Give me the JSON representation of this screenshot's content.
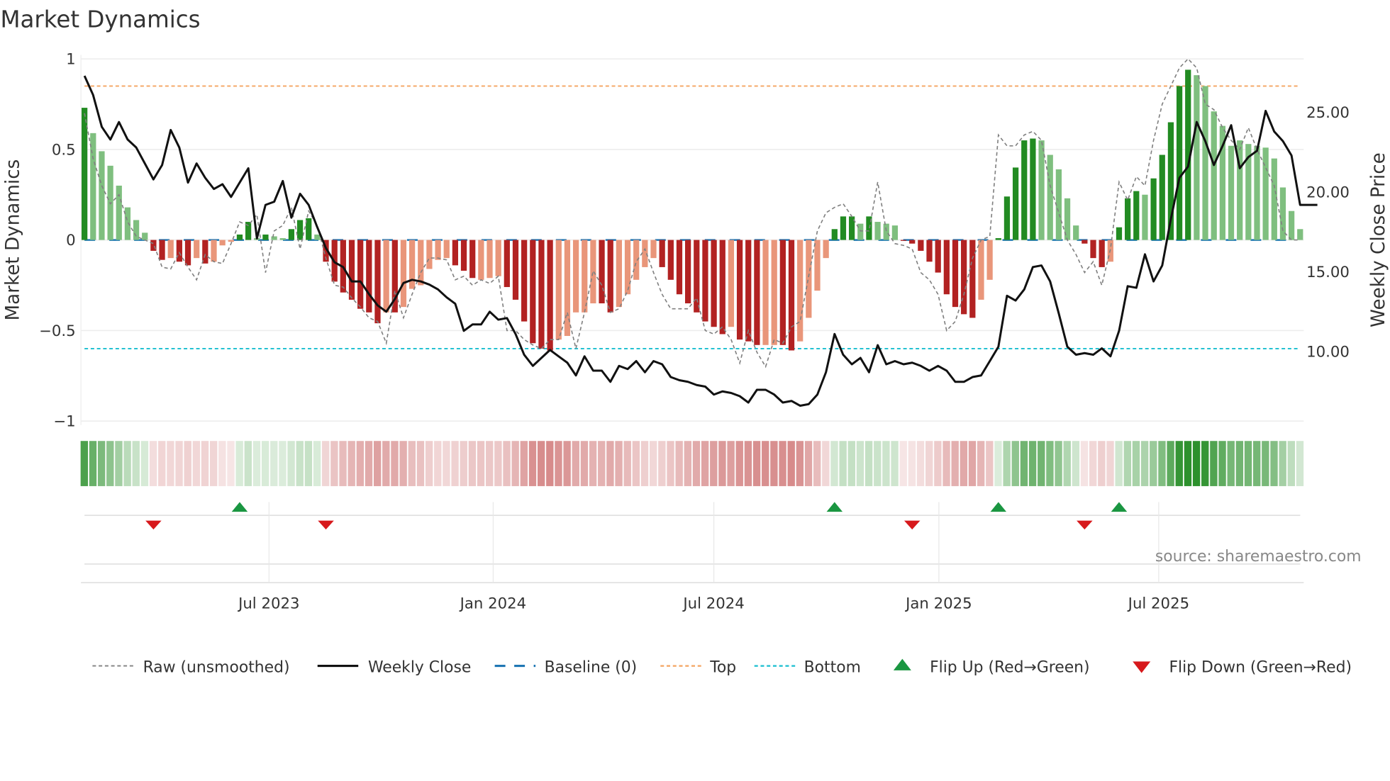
{
  "chart_data": {
    "type": "bar",
    "title": "Market Dynamics",
    "ylabel": "Market Dynamics",
    "y2label": "Weekly Close Price",
    "ylim": [
      -1,
      1
    ],
    "y2lim": [
      4.3,
      28.1
    ],
    "yticks": [
      {
        "v": 1,
        "label": "1"
      },
      {
        "v": 0.5,
        "label": "0.5"
      },
      {
        "v": 0,
        "label": "0"
      },
      {
        "v": -0.5,
        "label": "−0.5"
      },
      {
        "v": -1,
        "label": "−1"
      }
    ],
    "y2ticks": [
      {
        "v": 25,
        "label": "25.00"
      },
      {
        "v": 20,
        "label": "20.00"
      },
      {
        "v": 15,
        "label": "15.00"
      },
      {
        "v": 10,
        "label": "10.00"
      }
    ],
    "xticks": [
      {
        "week": 21.4,
        "label": "Jul 2023"
      },
      {
        "week": 47.4,
        "label": "Jan 2024"
      },
      {
        "week": 73.0,
        "label": "Jul 2024"
      },
      {
        "week": 99.1,
        "label": "Jan 2025"
      },
      {
        "week": 124.6,
        "label": "Jul 2025"
      }
    ],
    "top_level": 0.85,
    "bottom_level": -0.6,
    "baseline": 0,
    "dynamics": [
      0.73,
      0.59,
      0.49,
      0.41,
      0.3,
      0.18,
      0.11,
      0.04,
      -0.06,
      -0.11,
      -0.1,
      -0.12,
      -0.14,
      -0.1,
      -0.13,
      -0.12,
      -0.03,
      -0.01,
      0.03,
      0.1,
      0.01,
      0.03,
      0.02,
      0.01,
      0.06,
      0.11,
      0.12,
      0.03,
      -0.12,
      -0.23,
      -0.29,
      -0.33,
      -0.38,
      -0.4,
      -0.46,
      -0.4,
      -0.4,
      -0.37,
      -0.27,
      -0.25,
      -0.16,
      -0.11,
      -0.1,
      -0.14,
      -0.17,
      -0.21,
      -0.22,
      -0.21,
      -0.2,
      -0.26,
      -0.33,
      -0.45,
      -0.57,
      -0.6,
      -0.61,
      -0.55,
      -0.53,
      -0.4,
      -0.4,
      -0.35,
      -0.35,
      -0.4,
      -0.37,
      -0.3,
      -0.22,
      -0.15,
      -0.1,
      -0.15,
      -0.22,
      -0.3,
      -0.35,
      -0.4,
      -0.45,
      -0.48,
      -0.52,
      -0.48,
      -0.55,
      -0.56,
      -0.58,
      -0.58,
      -0.58,
      -0.58,
      -0.61,
      -0.56,
      -0.43,
      -0.28,
      -0.1,
      0.06,
      0.13,
      0.13,
      0.09,
      0.13,
      0.1,
      0.09,
      0.08,
      -0.005,
      -0.02,
      -0.06,
      -0.12,
      -0.18,
      -0.3,
      -0.37,
      -0.41,
      -0.43,
      -0.33,
      -0.22,
      0.01,
      0.24,
      0.4,
      0.55,
      0.56,
      0.55,
      0.47,
      0.39,
      0.23,
      0.08,
      -0.02,
      -0.1,
      -0.15,
      -0.12,
      0.07,
      0.23,
      0.27,
      0.25,
      0.34,
      0.47,
      0.65,
      0.85,
      0.94,
      0.91,
      0.85,
      0.71,
      0.63,
      0.52,
      0.55,
      0.53,
      0.52,
      0.51,
      0.45,
      0.29,
      0.16,
      0.06
    ],
    "strength": "DLLLLLLLDDLDDLDLLLDDLDLLDDDLDDDDDDDLDLLLLLLDDDLLLDDDDDDLLLLLDDLLLLLDDDDDDDDLDDDLLDDLLLLDDDLDLLLDDDDDDDDDLLDDDDDLLLLLDDDLDDDLDDDDDLLLLLLLLLLLLL",
    "raw": [
      0.7,
      0.45,
      0.3,
      0.2,
      0.25,
      0.1,
      0.02,
      0.0,
      -0.02,
      -0.15,
      -0.16,
      -0.07,
      -0.15,
      -0.22,
      -0.08,
      -0.12,
      -0.13,
      -0.02,
      0.1,
      0.08,
      0.14,
      -0.18,
      0.05,
      0.08,
      0.18,
      -0.05,
      0.16,
      0.08,
      -0.1,
      -0.25,
      -0.26,
      -0.32,
      -0.37,
      -0.43,
      -0.45,
      -0.57,
      -0.28,
      -0.43,
      -0.3,
      -0.18,
      -0.1,
      -0.1,
      -0.11,
      -0.22,
      -0.2,
      -0.25,
      -0.22,
      -0.24,
      -0.2,
      -0.5,
      -0.5,
      -0.55,
      -0.58,
      -0.6,
      -0.55,
      -0.55,
      -0.4,
      -0.6,
      -0.4,
      -0.17,
      -0.25,
      -0.4,
      -0.38,
      -0.28,
      -0.12,
      -0.05,
      -0.18,
      -0.3,
      -0.38,
      -0.38,
      -0.38,
      -0.32,
      -0.5,
      -0.52,
      -0.48,
      -0.55,
      -0.68,
      -0.5,
      -0.62,
      -0.7,
      -0.55,
      -0.57,
      -0.48,
      -0.45,
      -0.2,
      0.05,
      0.15,
      0.18,
      0.2,
      0.13,
      0.05,
      0.05,
      0.32,
      0.05,
      -0.02,
      -0.03,
      -0.05,
      -0.18,
      -0.22,
      -0.3,
      -0.5,
      -0.45,
      -0.3,
      -0.1,
      0.0,
      0.02,
      0.58,
      0.52,
      0.52,
      0.58,
      0.6,
      0.55,
      0.3,
      0.15,
      0.0,
      -0.08,
      -0.18,
      -0.12,
      -0.25,
      -0.05,
      0.32,
      0.22,
      0.35,
      0.3,
      0.55,
      0.75,
      0.85,
      0.95,
      1.0,
      0.95,
      0.75,
      0.72,
      0.62,
      0.55,
      0.5,
      0.62,
      0.5,
      0.4,
      0.3,
      0.05,
      0.0,
      0.0
    ],
    "close": [
      27.3,
      26.1,
      24.1,
      23.3,
      24.4,
      23.3,
      22.8,
      21.8,
      20.8,
      21.7,
      23.9,
      22.8,
      20.6,
      21.8,
      20.9,
      20.2,
      20.5,
      19.7,
      20.6,
      21.5,
      17.1,
      19.2,
      19.4,
      20.7,
      18.4,
      19.9,
      19.2,
      17.8,
      16.5,
      15.6,
      15.3,
      14.4,
      14.4,
      13.6,
      12.9,
      12.5,
      13.3,
      14.3,
      14.5,
      14.4,
      14.2,
      13.9,
      13.4,
      13.0,
      11.3,
      11.7,
      11.7,
      12.5,
      12.0,
      12.1,
      11.1,
      9.8,
      9.1,
      9.6,
      10.1,
      9.7,
      9.3,
      8.5,
      9.7,
      8.8,
      8.8,
      8.1,
      9.1,
      8.9,
      9.4,
      8.7,
      9.4,
      9.2,
      8.4,
      8.2,
      8.1,
      7.9,
      7.8,
      7.3,
      7.5,
      7.4,
      7.2,
      6.8,
      7.6,
      7.6,
      7.3,
      6.8,
      6.9,
      6.6,
      6.7,
      7.3,
      8.7,
      11.1,
      9.8,
      9.2,
      9.6,
      8.7,
      10.4,
      9.2,
      9.4,
      9.2,
      9.3,
      9.1,
      8.8,
      9.1,
      8.8,
      8.1,
      8.1,
      8.4,
      8.5,
      9.4,
      10.3,
      13.5,
      13.2,
      13.9,
      15.3,
      15.4,
      14.4,
      12.4,
      10.3,
      9.8,
      9.9,
      9.8,
      10.2,
      9.7,
      11.3,
      14.1,
      14.0,
      16.1,
      14.4,
      15.4,
      18.3,
      20.9,
      21.6,
      24.4,
      23.2,
      21.7,
      22.9,
      24.2,
      21.5,
      22.2,
      22.6,
      25.1,
      23.8,
      23.2,
      22.3,
      19.2,
      19.2,
      19.2
    ],
    "flip_up_weeks": [
      18,
      87,
      106,
      120
    ],
    "flip_down_weeks": [
      8,
      28,
      96,
      116
    ],
    "legend": {
      "placement": "bottom",
      "raw": "Raw (unsmoothed)",
      "close": "Weekly Close",
      "baseline": "Baseline (0)",
      "top": "Top",
      "bottom": "Bottom",
      "flip_up": "Flip Up (Red→Green)",
      "flip_down": "Flip Down (Green→Red)"
    },
    "source": "source: sharemaestro.com"
  },
  "colors": {
    "green_strong": "#228b22",
    "green_light": "#7fbf7f",
    "red_strong": "#b22222",
    "red_light": "#e9967a",
    "top": "#f4a460",
    "bottom": "#17becf",
    "baseline": "#1f77b4",
    "close": "#111111",
    "raw": "#808080",
    "flip_up": "#1a9641",
    "flip_down": "#d7191c"
  }
}
